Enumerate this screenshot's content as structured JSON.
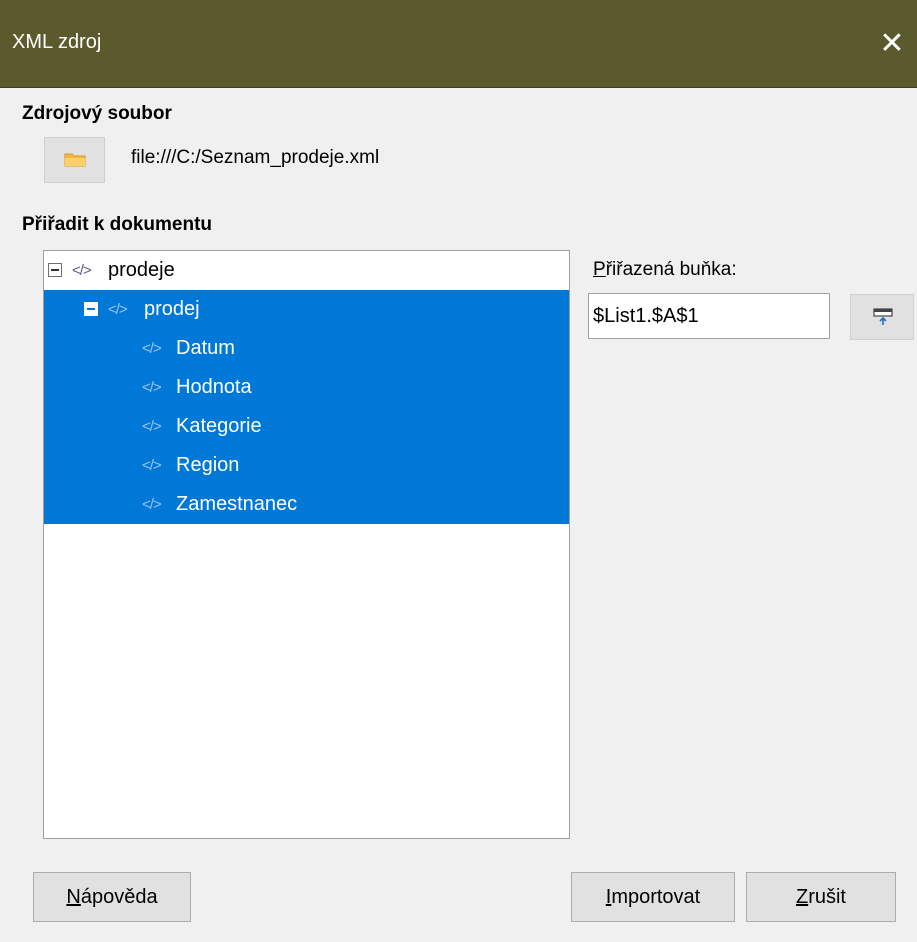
{
  "window": {
    "title": "XML zdroj",
    "close_glyph": "✕"
  },
  "source": {
    "heading": "Zdrojový soubor",
    "browse_icon": "folder-icon",
    "file_path": "file:///C:/Seznam_prodeje.xml"
  },
  "mapping": {
    "heading": "Přiřadit k dokumentu",
    "tree": [
      {
        "label": "prodeje",
        "expander": true,
        "selected": false,
        "level": 0
      },
      {
        "label": "prodej",
        "expander": true,
        "selected": true,
        "level": 1
      },
      {
        "label": "Datum",
        "expander": false,
        "selected": true,
        "level": 2
      },
      {
        "label": "Hodnota",
        "expander": false,
        "selected": true,
        "level": 2
      },
      {
        "label": "Kategorie",
        "expander": false,
        "selected": true,
        "level": 2
      },
      {
        "label": "Region",
        "expander": false,
        "selected": true,
        "level": 2
      },
      {
        "label": "Zamestnanec",
        "expander": false,
        "selected": true,
        "level": 2
      }
    ],
    "tag_glyph": "</>"
  },
  "linked_cell": {
    "label_first": "P",
    "label_rest": "řiřazená buňka:",
    "value": "$List1.$A$1",
    "shrink_icon": "shrink-icon"
  },
  "buttons": {
    "help_first": "N",
    "help_rest": "ápověda",
    "import_first": "I",
    "import_rest": "mportovat",
    "cancel_first": "Z",
    "cancel_rest": "rušit"
  },
  "colors": {
    "titlebar": "#5b5a2d",
    "selection": "#0078d7",
    "folder": "#f5b940"
  }
}
